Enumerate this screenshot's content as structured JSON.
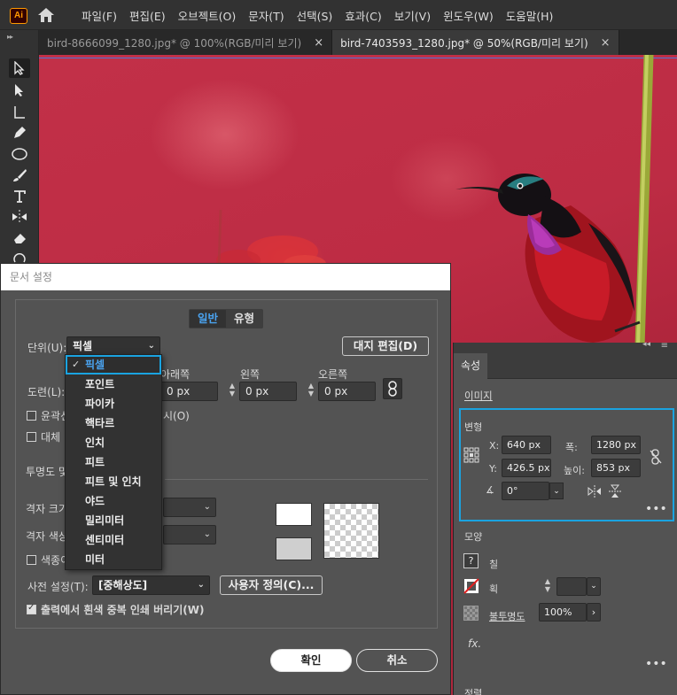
{
  "app": {
    "logo": "Ai"
  },
  "menu": [
    "파일(F)",
    "편집(E)",
    "오브젝트(O)",
    "문자(T)",
    "선택(S)",
    "효과(C)",
    "보기(V)",
    "윈도우(W)",
    "도움말(H)"
  ],
  "tabs": [
    {
      "label": "bird-8666099_1280.jpg* @ 100%(RGB/미리 보기)",
      "close": "×"
    },
    {
      "label": "bird-7403593_1280.jpg* @ 50%(RGB/미리 보기)",
      "close": "×"
    }
  ],
  "dialog": {
    "title": "문서 설정",
    "tabs": [
      "일반",
      "유형"
    ],
    "unit_label": "단위(U):",
    "unit_value": "픽셀",
    "edit_artboards": "대지 편집(D)",
    "bleed_label": "도련(L):",
    "bleed_headers": {
      "bottom": "아래쪽",
      "left": "왼쪽",
      "right": "오른쪽"
    },
    "bleed_values": {
      "bottom": "0 px",
      "left": "0 px",
      "right": "0 px"
    },
    "outline_label": "윤곽선",
    "outline_suffix": "시(O)",
    "substitute_label": "대체",
    "transparency_label": "투명도 및",
    "grid_size_label": "격자 크기",
    "grid_color_label": "격자 색상",
    "paper_color_label": "색종이",
    "preset_label": "사전 설정(T):",
    "preset_value": "[중해상도]",
    "custom_button": "사용자 정의(C)...",
    "discard_label": "출력에서 흰색 중복 인쇄 버리기(W)",
    "ok": "확인",
    "cancel": "취소"
  },
  "units_dropdown": {
    "check": "✓",
    "items": [
      "픽셀",
      "포인트",
      "파이카",
      "핵타르",
      "인치",
      "피트",
      "피트 및 인치",
      "야드",
      "밀리미터",
      "센티미터",
      "미터"
    ],
    "selected": "픽셀"
  },
  "properties": {
    "tab": "속성",
    "section_image": "이미지",
    "transform": {
      "title": "변형",
      "x_label": "X:",
      "x": "640 px",
      "y_label": "Y:",
      "y": "426.5 px",
      "w_label": "폭:",
      "w": "1280 px",
      "h_label": "높이:",
      "h": "853 px",
      "angle": "0°"
    },
    "appearance": {
      "title": "모양",
      "fill_label": "칠",
      "stroke_label": "획",
      "opacity_label": "불투명도",
      "opacity": "100%",
      "fx": "fx."
    },
    "align_title": "정렬"
  }
}
